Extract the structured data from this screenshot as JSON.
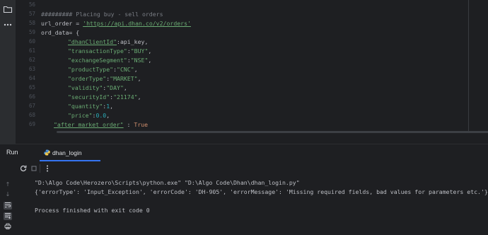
{
  "left_strip": {
    "icons": [
      "folder-icon",
      "more-icon"
    ]
  },
  "editor": {
    "line_numbers": [
      "56",
      "57",
      "58",
      "59",
      "60",
      "61",
      "62",
      "63",
      "64",
      "65",
      "66",
      "67",
      "68",
      "69"
    ],
    "lines": {
      "l57": "######### Placing buy - sell orders",
      "l58_var": "url_order = ",
      "l58_str": "'https://api.dhan.co/v2/orders'",
      "l59": "ord_data= {",
      "l60_key": "\"dhanClientId\"",
      "l60_val": ":api_key,",
      "l61_key": "\"transactionType\"",
      "l61_sep": ":",
      "l61_val": "\"BUY\"",
      "l61_end": ",",
      "l62_key": "\"exchangeSegment\"",
      "l62_sep": ":",
      "l62_val": "\"NSE\"",
      "l62_end": ",",
      "l63_key": "\"productType\"",
      "l63_sep": ":",
      "l63_val": "\"CNC\"",
      "l63_end": ",",
      "l64_key": "\"orderType\"",
      "l64_sep": ":",
      "l64_val": "\"MARKET\"",
      "l64_end": ",",
      "l65_key": "\"validity\"",
      "l65_sep": ":",
      "l65_val": "\"DAY\"",
      "l65_end": ",",
      "l66_key": "\"securityId\"",
      "l66_sep": ":",
      "l66_val": "\"21174\"",
      "l66_end": ",",
      "l67_key": "\"quantity\"",
      "l67_sep": ":",
      "l67_val": "1",
      "l67_end": ",",
      "l68_key": "\"price\"",
      "l68_sep": ":",
      "l68_val": "0.0",
      "l68_end": ",",
      "l69_key": "\"after_market_order\"",
      "l69_sep": " : ",
      "l69_val": "True"
    }
  },
  "run_panel": {
    "title": "Run",
    "tab_label": "dhan_login",
    "console": [
      "\"D:\\Algo Code\\Herozero\\Scripts\\python.exe\" \"D:\\Algo Code\\Dhan\\dhan_login.py\"",
      "{'errorType': 'Input_Exception', 'errorCode': 'DH-905', 'errorMessage': 'Missing required fields, bad values for parameters etc.'}",
      "",
      "Process finished with exit code 0"
    ]
  },
  "colors": {
    "background": "#1e1f22",
    "string": "#6aab73",
    "number": "#2aacb8",
    "keyword": "#cf8e6d",
    "comment": "#7a7e85",
    "tab_underline": "#3574f0"
  }
}
